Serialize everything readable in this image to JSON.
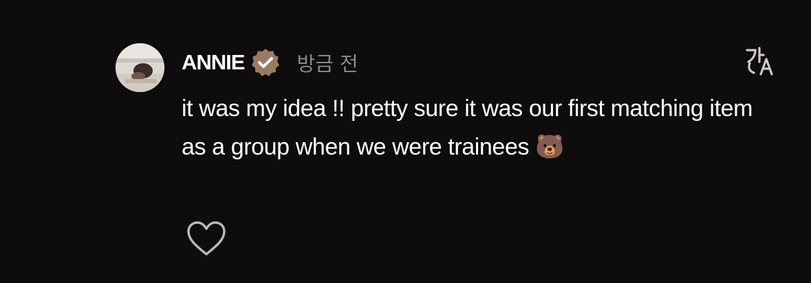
{
  "comment": {
    "author": "ANNIE",
    "verified": true,
    "timestamp": "방금 전",
    "text": "it was my idea !! pretty sure it was our first matching item as a group when we were trainees 🐻"
  },
  "icons": {
    "avatar": "avatar-photo",
    "verified": "verified-badge-icon",
    "translate": "translate-icon",
    "like": "heart-outline-icon"
  },
  "colors": {
    "background": "#0e0c0c",
    "text": "#ffffff",
    "muted": "#8b8786",
    "badge": "#9a7b62"
  }
}
